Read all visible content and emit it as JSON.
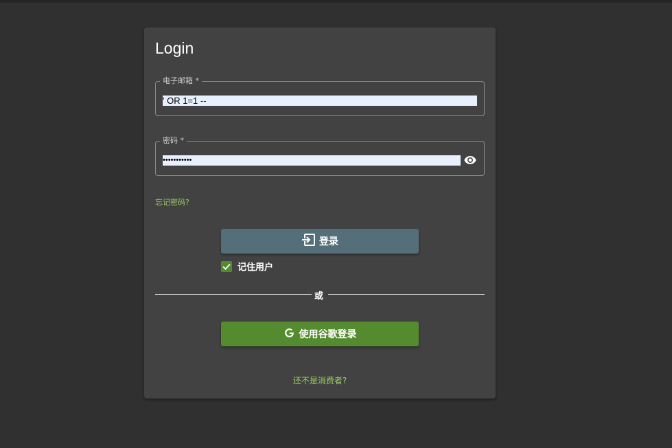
{
  "login": {
    "title": "Login",
    "email": {
      "label": "电子邮箱 *",
      "value": "' OR 1=1 --"
    },
    "password": {
      "label": "密码 *",
      "value": "•••••••••••",
      "toggle_icon": "eye-icon"
    },
    "forgot_link": "忘记密码?",
    "login_button": {
      "label": "登录",
      "icon": "login-icon"
    },
    "remember": {
      "label": "记住用户",
      "checked": true
    },
    "divider": "或",
    "google_button": {
      "label": "使用谷歌登录",
      "icon": "google-icon"
    },
    "signup_link": "还不是消费者?"
  },
  "colors": {
    "background": "#303030",
    "card": "#424242",
    "accent_green": "#558b2f",
    "link_green": "#9ccc65",
    "login_button": "#546e7a"
  }
}
